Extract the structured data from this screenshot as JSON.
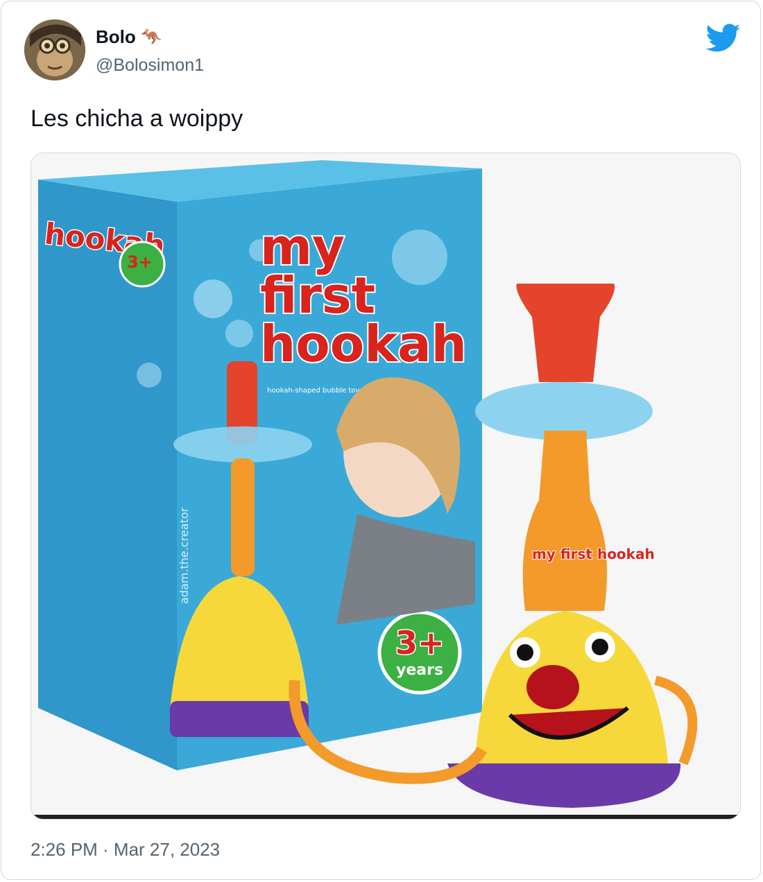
{
  "tweet": {
    "author_name": "Bolo",
    "author_emoji": "🦘",
    "handle": "@Bolosimon1",
    "text": "Les chicha a woippy",
    "timestamp": "2:26 PM · Mar 27, 2023"
  },
  "media": {
    "box_title_line1": "my",
    "box_title_line2": "first",
    "box_title_line3": "hookah",
    "box_subtitle": "hookah-shaped bubble toy",
    "age_badge_number": "3+",
    "age_badge_label": "years",
    "side_watermark": "adam.the.creator",
    "toy_label": "my first hookah"
  },
  "colors": {
    "brand_blue": "#1d9bf0",
    "box_blue": "#3aa9d8",
    "title_red": "#d9231d",
    "badge_green": "#3cb043"
  },
  "icons": {
    "platform": "twitter-bird-icon"
  }
}
